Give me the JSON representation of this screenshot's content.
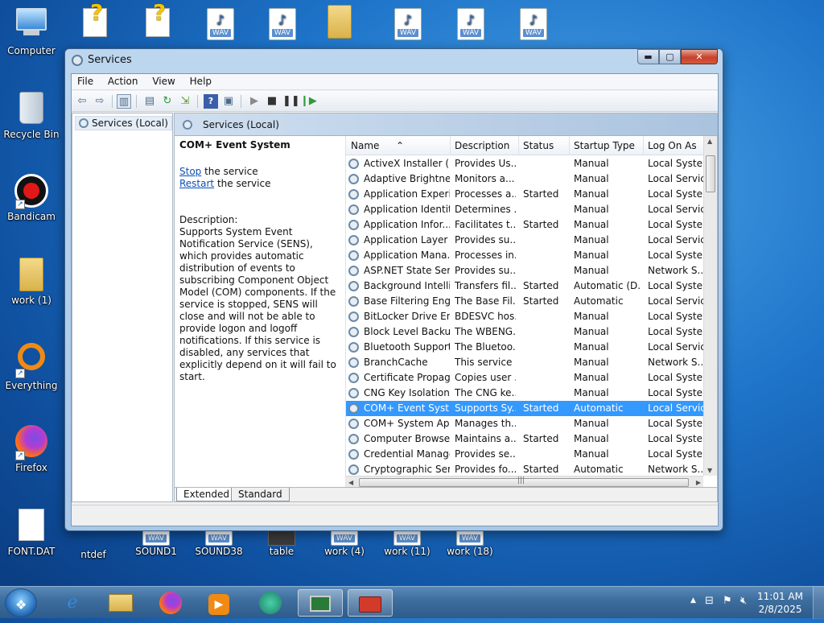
{
  "desktop": {
    "left_icons": [
      {
        "label": "Computer"
      },
      {
        "label": "Recycle Bin"
      },
      {
        "label": "Bandicam"
      },
      {
        "label": "work (1)"
      },
      {
        "label": "Everything"
      },
      {
        "label": "Firefox"
      },
      {
        "label": "FONT.DAT"
      }
    ],
    "top_icons": [
      {
        "label": "",
        "type": "help-doc"
      },
      {
        "label": "",
        "type": "help-doc"
      },
      {
        "label": "",
        "type": "wav",
        "tag": "WAV"
      },
      {
        "label": "",
        "type": "wav",
        "tag": "WAV"
      },
      {
        "label": "",
        "type": "zip-folder"
      },
      {
        "label": "",
        "type": "wav",
        "tag": "WAV"
      },
      {
        "label": "",
        "type": "wav",
        "tag": "WAV"
      },
      {
        "label": "",
        "type": "wav",
        "tag": "WAV"
      }
    ],
    "bottom_icons": [
      {
        "label": "ntdef"
      },
      {
        "label": "SOUND1",
        "tag": "WAV"
      },
      {
        "label": "SOUND38",
        "tag": "WAV"
      },
      {
        "label": "table"
      },
      {
        "label": "work (4)",
        "tag": "WAV"
      },
      {
        "label": "work (11)",
        "tag": "WAV"
      },
      {
        "label": "work (18)",
        "tag": "WAV"
      }
    ]
  },
  "window": {
    "title": "Services",
    "buttons": {
      "minimize": "▬",
      "maximize": "▢",
      "close": "✕"
    },
    "menu": [
      "File",
      "Action",
      "View",
      "Help"
    ],
    "tree_node": "Services (Local)",
    "pane_header": "Services (Local)",
    "detail": {
      "service_name": "COM+ Event System",
      "stop_link": "Stop",
      "stop_suffix": " the service",
      "restart_link": "Restart",
      "restart_suffix": " the service",
      "description_label": "Description:",
      "description": "Supports System Event Notification Service (SENS), which provides automatic distribution of events to subscribing Component Object Model (COM) components. If the service is stopped, SENS will close and will not be able to provide logon and logoff notifications. If this service is disabled, any services that explicitly depend on it will fail to start."
    },
    "columns": [
      "Name",
      "Description",
      "Status",
      "Startup Type",
      "Log On As"
    ],
    "rows": [
      [
        "ActiveX Installer (...",
        "Provides Us...",
        "",
        "Manual",
        "Local Syste..."
      ],
      [
        "Adaptive Brightness",
        "Monitors a...",
        "",
        "Manual",
        "Local Service"
      ],
      [
        "Application Experi...",
        "Processes a...",
        "Started",
        "Manual",
        "Local Syste..."
      ],
      [
        "Application Identity",
        "Determines ...",
        "",
        "Manual",
        "Local Service"
      ],
      [
        "Application Infor...",
        "Facilitates t...",
        "Started",
        "Manual",
        "Local Syste..."
      ],
      [
        "Application Layer ...",
        "Provides su...",
        "",
        "Manual",
        "Local Service"
      ],
      [
        "Application Mana...",
        "Processes in...",
        "",
        "Manual",
        "Local Syste..."
      ],
      [
        "ASP.NET State Ser...",
        "Provides su...",
        "",
        "Manual",
        "Network S..."
      ],
      [
        "Background Intelli...",
        "Transfers fil...",
        "Started",
        "Automatic (D...",
        "Local Syste..."
      ],
      [
        "Base Filtering Engi...",
        "The Base Fil...",
        "Started",
        "Automatic",
        "Local Service"
      ],
      [
        "BitLocker Drive En...",
        "BDESVC hos...",
        "",
        "Manual",
        "Local Syste..."
      ],
      [
        "Block Level Backu...",
        "The WBENG...",
        "",
        "Manual",
        "Local Syste..."
      ],
      [
        "Bluetooth Support...",
        "The Bluetoo...",
        "",
        "Manual",
        "Local Service"
      ],
      [
        "BranchCache",
        "This service ...",
        "",
        "Manual",
        "Network S..."
      ],
      [
        "Certificate Propag...",
        "Copies user ...",
        "",
        "Manual",
        "Local Syste..."
      ],
      [
        "CNG Key Isolation",
        "The CNG ke...",
        "",
        "Manual",
        "Local Syste..."
      ],
      [
        "COM+ Event Syst...",
        "Supports Sy...",
        "Started",
        "Automatic",
        "Local Service"
      ],
      [
        "COM+ System Ap...",
        "Manages th...",
        "",
        "Manual",
        "Local Syste..."
      ],
      [
        "Computer Browser",
        "Maintains a...",
        "Started",
        "Manual",
        "Local Syste..."
      ],
      [
        "Credential Manager",
        "Provides se...",
        "",
        "Manual",
        "Local Syste..."
      ],
      [
        "Cryptographic Ser...",
        "Provides fo...",
        "Started",
        "Automatic",
        "Network S..."
      ]
    ],
    "selected_row": 16,
    "tabs": [
      "Extended",
      "Standard"
    ],
    "hscroll_grip": "|||"
  },
  "taskbar": {
    "clock_time": "11:01 AM",
    "clock_date": "2/8/2025"
  },
  "colors": {
    "selection": "#3399ff",
    "link": "#0a4fb5",
    "desktop": "#1e74c9"
  }
}
